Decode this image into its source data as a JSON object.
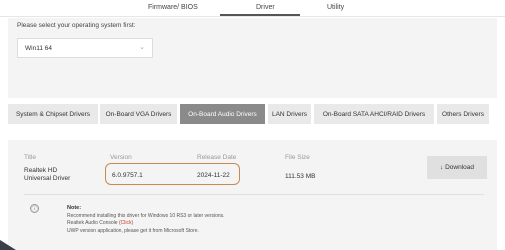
{
  "top_tabs": {
    "firmware": "Firmware/ BIOS",
    "driver": "Driver",
    "utility": "Utility"
  },
  "os_selector": {
    "prompt": "Please select your operating system first:",
    "selected": "Win11 64",
    "chevron": "⌄"
  },
  "categories": [
    "System & Chipset Drivers",
    "On-Board VGA Drivers",
    "On-Board Audio Drivers",
    "LAN Drivers",
    "On-Board SATA AHCI/RAID Drivers",
    "Others Drivers"
  ],
  "active_category": "On-Board Audio Drivers",
  "table": {
    "headers": {
      "title": "Title",
      "version": "Version",
      "release_date": "Release Date",
      "file_size": "File Size"
    },
    "row": {
      "title_line1": "Realtek HD",
      "title_line2": "Universal Driver",
      "version": "6.0.9757.1",
      "release_date": "2024-11-22",
      "file_size": "111.53 MB"
    }
  },
  "download_label": "↓ Download",
  "note": {
    "icon": "ⓘ",
    "title": "Note:",
    "line1": "Recommend installing this driver for Windows 10 RS3 or later versions.",
    "line2_prefix": "Realtek Audio Console (",
    "line2_link": "Click",
    "line2_suffix": ")",
    "line3": "UWP version application, please get it from Microsoft Store."
  },
  "colors": {
    "active_tab": "#8a8a8a",
    "highlight_border": "#c98a52",
    "link": "#d23c2c"
  }
}
